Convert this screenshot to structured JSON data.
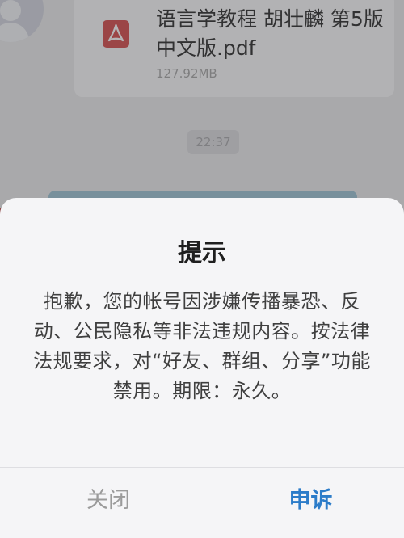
{
  "chat": {
    "file": {
      "icon": "pdf-icon",
      "name": "语言学教程 胡壮麟 第5版中文版.pdf",
      "size": "127.92MB"
    },
    "timestamp": "22:37"
  },
  "dialog": {
    "title": "提示",
    "message": "抱歉，您的帐号因涉嫌传播暴恐、反动、公民隐私等非法违规内容。按法律法规要求，对“好友、群组、分享”功能禁用。期限：永久。",
    "buttons": {
      "close_label": "关闭",
      "appeal_label": "申诉"
    }
  },
  "colors": {
    "pdf_icon": "#d64b4b",
    "appeal_accent": "#2c7cc9",
    "close_text": "#9b9b9b"
  }
}
